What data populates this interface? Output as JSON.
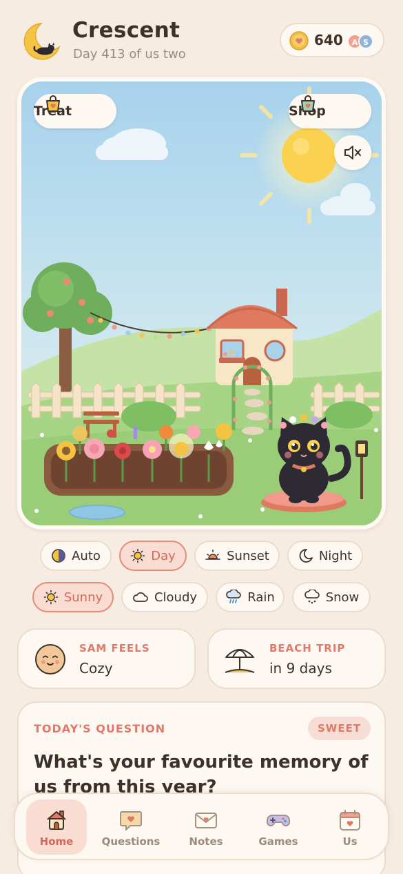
{
  "header": {
    "title": "Crescent",
    "subtitle": "Day 413 of us two",
    "coins": "640",
    "avatars": [
      "A",
      "S"
    ]
  },
  "scene": {
    "treat_label": "Treat",
    "shop_label": "Shop",
    "icons": {
      "treat": "treat-bag-icon",
      "shop": "shop-bag-icon",
      "mute": "speaker-muted-icon"
    }
  },
  "time_modes": [
    {
      "label": "Auto",
      "icon": "auto-half-moon-icon",
      "active": false
    },
    {
      "label": "Day",
      "icon": "sun-icon",
      "active": true
    },
    {
      "label": "Sunset",
      "icon": "sunset-icon",
      "active": false
    },
    {
      "label": "Night",
      "icon": "crescent-moon-icon",
      "active": false
    }
  ],
  "weather_modes": [
    {
      "label": "Sunny",
      "icon": "sun-icon",
      "active": true
    },
    {
      "label": "Cloudy",
      "icon": "cloud-icon",
      "active": false
    },
    {
      "label": "Rain",
      "icon": "rain-cloud-icon",
      "active": false
    },
    {
      "label": "Snow",
      "icon": "snow-cloud-icon",
      "active": false
    }
  ],
  "mood_card": {
    "label": "SAM FEELS",
    "value": "Cozy"
  },
  "trip_card": {
    "label": "BEACH TRIP",
    "value": "in 9 days"
  },
  "question": {
    "label": "TODAY'S QUESTION",
    "badge": "SWEET",
    "text": "What's your favourite memory of us from this year?"
  },
  "nav": [
    {
      "label": "Home",
      "icon": "house-icon",
      "active": true
    },
    {
      "label": "Questions",
      "icon": "speech-heart-icon",
      "active": false
    },
    {
      "label": "Notes",
      "icon": "envelope-heart-icon",
      "active": false
    },
    {
      "label": "Games",
      "icon": "gamepad-icon",
      "active": false
    },
    {
      "label": "Us",
      "icon": "calendar-heart-icon",
      "active": false
    }
  ],
  "colors": {
    "background": "#f6ece1",
    "accent": "#e0796a",
    "card": "#fdf8f2",
    "sky": "#a9d3ea",
    "grass": "#9fd07e"
  }
}
